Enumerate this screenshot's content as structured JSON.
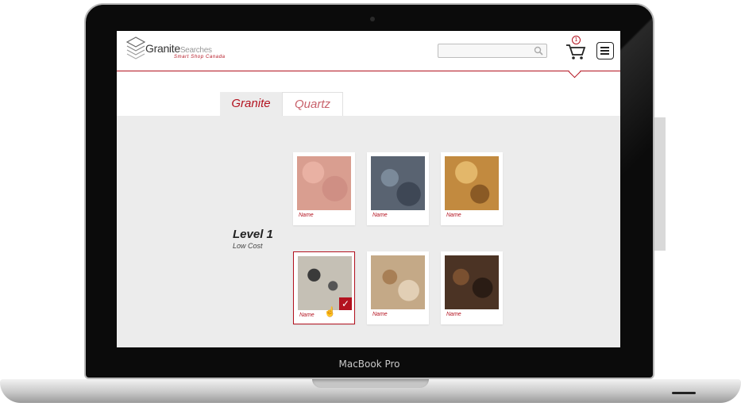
{
  "device": {
    "label": "MacBook Pro"
  },
  "site": {
    "brand_main": "Granite",
    "brand_secondary": "Searches",
    "tagline": "Smart Shop Canada"
  },
  "header": {
    "search_placeholder": "",
    "cart_count": "1",
    "icons": {
      "search": "search-icon",
      "cart": "cart-icon",
      "menu": "menu-icon"
    }
  },
  "tabs": [
    {
      "label": "Granite",
      "active": true
    },
    {
      "label": "Quartz",
      "active": false
    }
  ],
  "level": {
    "title": "Level 1",
    "subtitle": "Low Cost"
  },
  "products": [
    {
      "name": "Name",
      "selected": false
    },
    {
      "name": "Name",
      "selected": false
    },
    {
      "name": "Name",
      "selected": false
    },
    {
      "name": "Name",
      "selected": true
    },
    {
      "name": "Name",
      "selected": false
    },
    {
      "name": "Name",
      "selected": false
    }
  ],
  "colors": {
    "accent": "#b3121f",
    "panel": "#ececec"
  }
}
